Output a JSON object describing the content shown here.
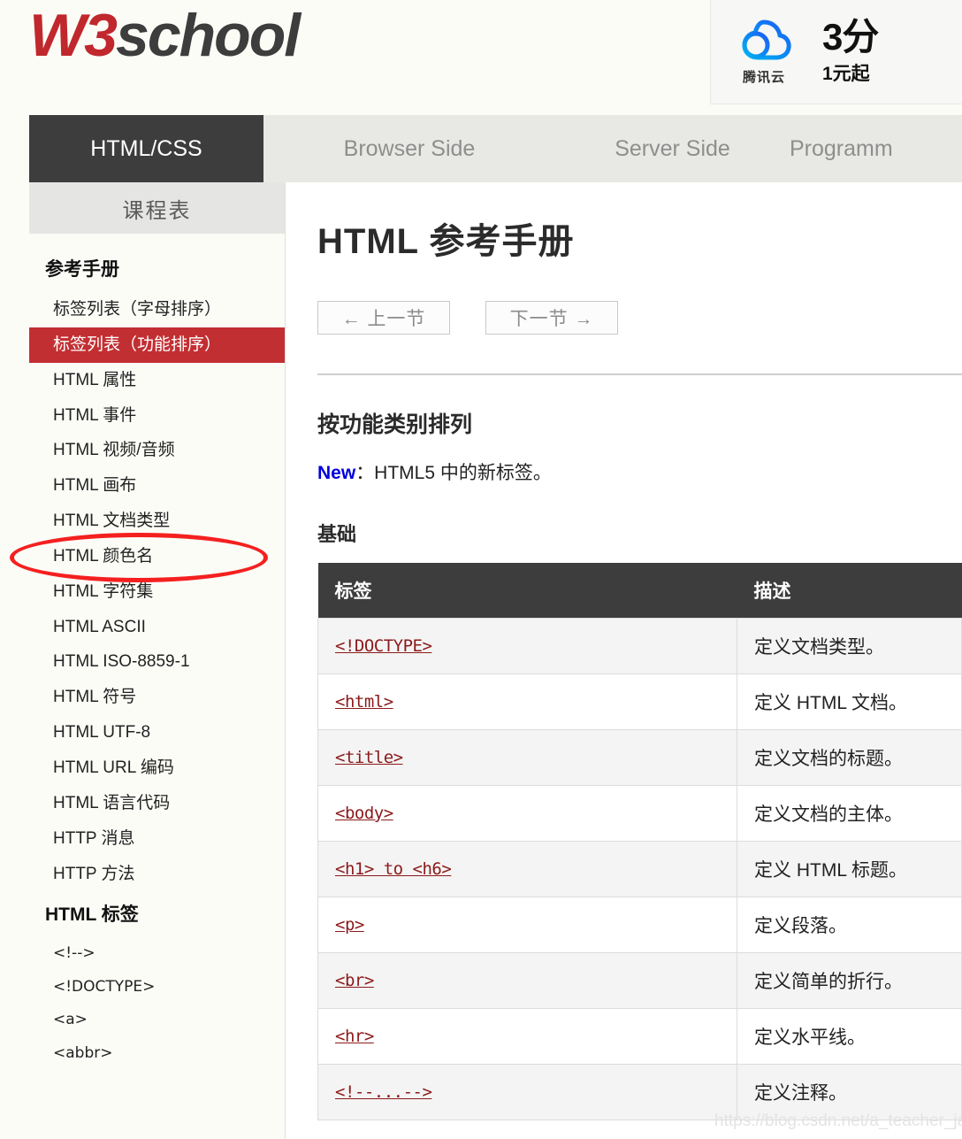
{
  "site": {
    "logo_primary": "W3",
    "logo_secondary": "school",
    "logo_color": "#c0282d"
  },
  "ad": {
    "brand": "腾讯云",
    "brand_icon": "cloud-icon",
    "headline": "3分",
    "sub": "1元起"
  },
  "nav": {
    "tabs": [
      {
        "label": "HTML/CSS",
        "active": true
      },
      {
        "label": "Browser Side",
        "active": false
      },
      {
        "label": "Server Side",
        "active": false
      },
      {
        "label": "Programm",
        "active": false
      }
    ]
  },
  "sidebar": {
    "header": "课程表",
    "groups": [
      {
        "title": "参考手册",
        "items": [
          {
            "label": "标签列表（字母排序）",
            "active": false,
            "type": "text"
          },
          {
            "label": "标签列表（功能排序）",
            "active": true,
            "type": "text"
          },
          {
            "label": "HTML 属性",
            "active": false,
            "type": "text"
          },
          {
            "label": "HTML 事件",
            "active": false,
            "type": "text"
          },
          {
            "label": "HTML 视频/音频",
            "active": false,
            "type": "text"
          },
          {
            "label": "HTML 画布",
            "active": false,
            "type": "text"
          },
          {
            "label": "HTML 文档类型",
            "active": false,
            "type": "text"
          },
          {
            "label": "HTML 颜色名",
            "active": false,
            "type": "text"
          },
          {
            "label": "HTML 字符集",
            "active": false,
            "type": "text"
          },
          {
            "label": "HTML ASCII",
            "active": false,
            "type": "text"
          },
          {
            "label": "HTML ISO-8859-1",
            "active": false,
            "type": "text"
          },
          {
            "label": "HTML 符号",
            "active": false,
            "type": "text"
          },
          {
            "label": "HTML UTF-8",
            "active": false,
            "type": "text"
          },
          {
            "label": "HTML URL 编码",
            "active": false,
            "type": "text"
          },
          {
            "label": "HTML 语言代码",
            "active": false,
            "type": "text"
          },
          {
            "label": "HTTP 消息",
            "active": false,
            "type": "text"
          },
          {
            "label": "HTTP 方法",
            "active": false,
            "type": "text"
          }
        ]
      },
      {
        "title": "HTML 标签",
        "items": [
          {
            "label": "<!-->",
            "active": false,
            "type": "tag"
          },
          {
            "label": "<!DOCTYPE>",
            "active": false,
            "type": "tag"
          },
          {
            "label": "<a>",
            "active": false,
            "type": "tag"
          },
          {
            "label": "<abbr>",
            "active": false,
            "type": "tag"
          }
        ]
      }
    ]
  },
  "main": {
    "title": "HTML 参考手册",
    "prev_button": "← 上一节",
    "next_button": "下一节 →",
    "section_title": "按功能类别排列",
    "note_new": "New",
    "note_rest": "：HTML5 中的新标签。",
    "sub_title": "基础",
    "table": {
      "headers": [
        "标签",
        "描述"
      ],
      "rows": [
        {
          "tag": "<!DOCTYPE>",
          "desc": "定义文档类型。"
        },
        {
          "tag": "<html>",
          "desc": "定义 HTML 文档。"
        },
        {
          "tag": "<title>",
          "desc": "定义文档的标题。"
        },
        {
          "tag": "<body>",
          "desc": "定义文档的主体。"
        },
        {
          "tag": "<h1> to <h6>",
          "desc": "定义 HTML 标题。"
        },
        {
          "tag": "<p>",
          "desc": "定义段落。"
        },
        {
          "tag": "<br>",
          "desc": "定义简单的折行。"
        },
        {
          "tag": "<hr>",
          "desc": "定义水平线。"
        },
        {
          "tag": "<!--...-->",
          "desc": "定义注释。"
        }
      ]
    }
  },
  "watermark": "https://blog.csdn.net/a_teacher_java"
}
